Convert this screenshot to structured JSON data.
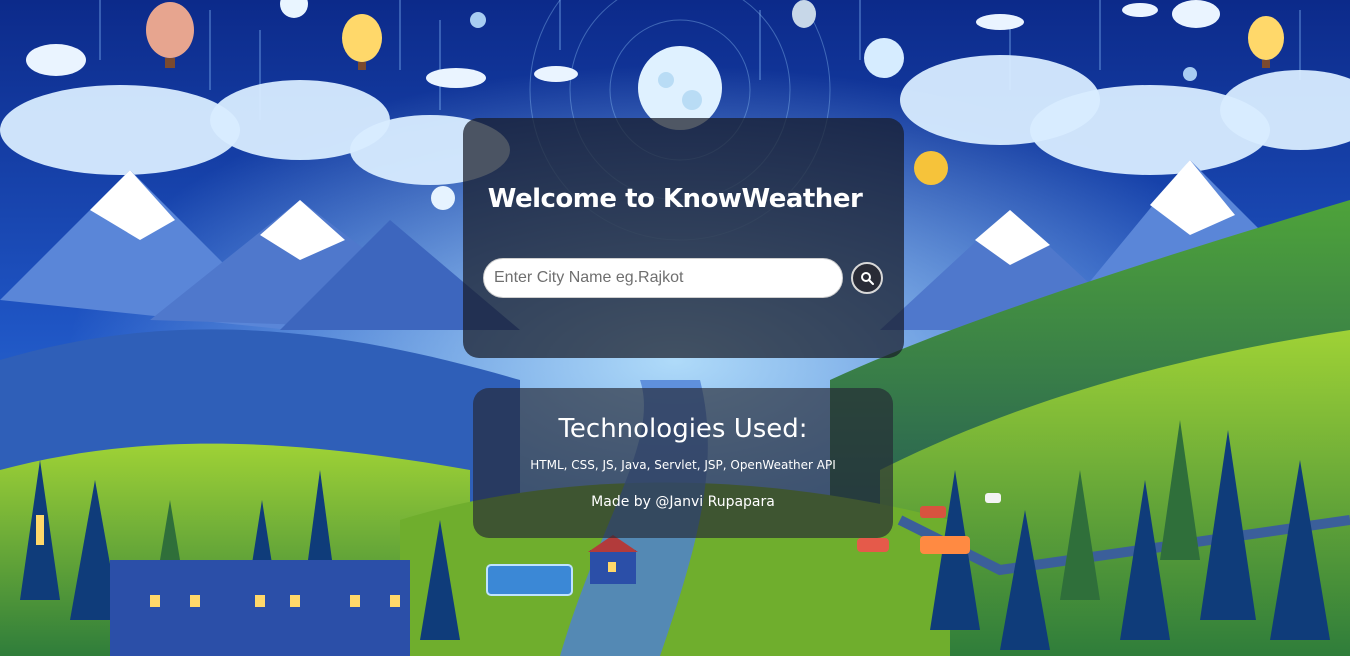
{
  "hero": {
    "title": "Welcome to KnowWeather",
    "search": {
      "placeholder": "Enter City Name eg.Rajkot",
      "value": "",
      "button_icon": "search-icon"
    }
  },
  "technologies": {
    "heading": "Technologies Used:",
    "list": "HTML, CSS, JS, Java, Servlet, JSP, OpenWeather API",
    "credit": "Made by @Janvi Rupapara"
  },
  "colors": {
    "night_sky": "#0f2f8c",
    "deep_blue": "#0a1f66",
    "hill_green": "#7dbd2f",
    "moon": "#dff1ff",
    "sun": "#f6c33a",
    "card_overlay": "#181c28",
    "text": "#ffffff"
  }
}
